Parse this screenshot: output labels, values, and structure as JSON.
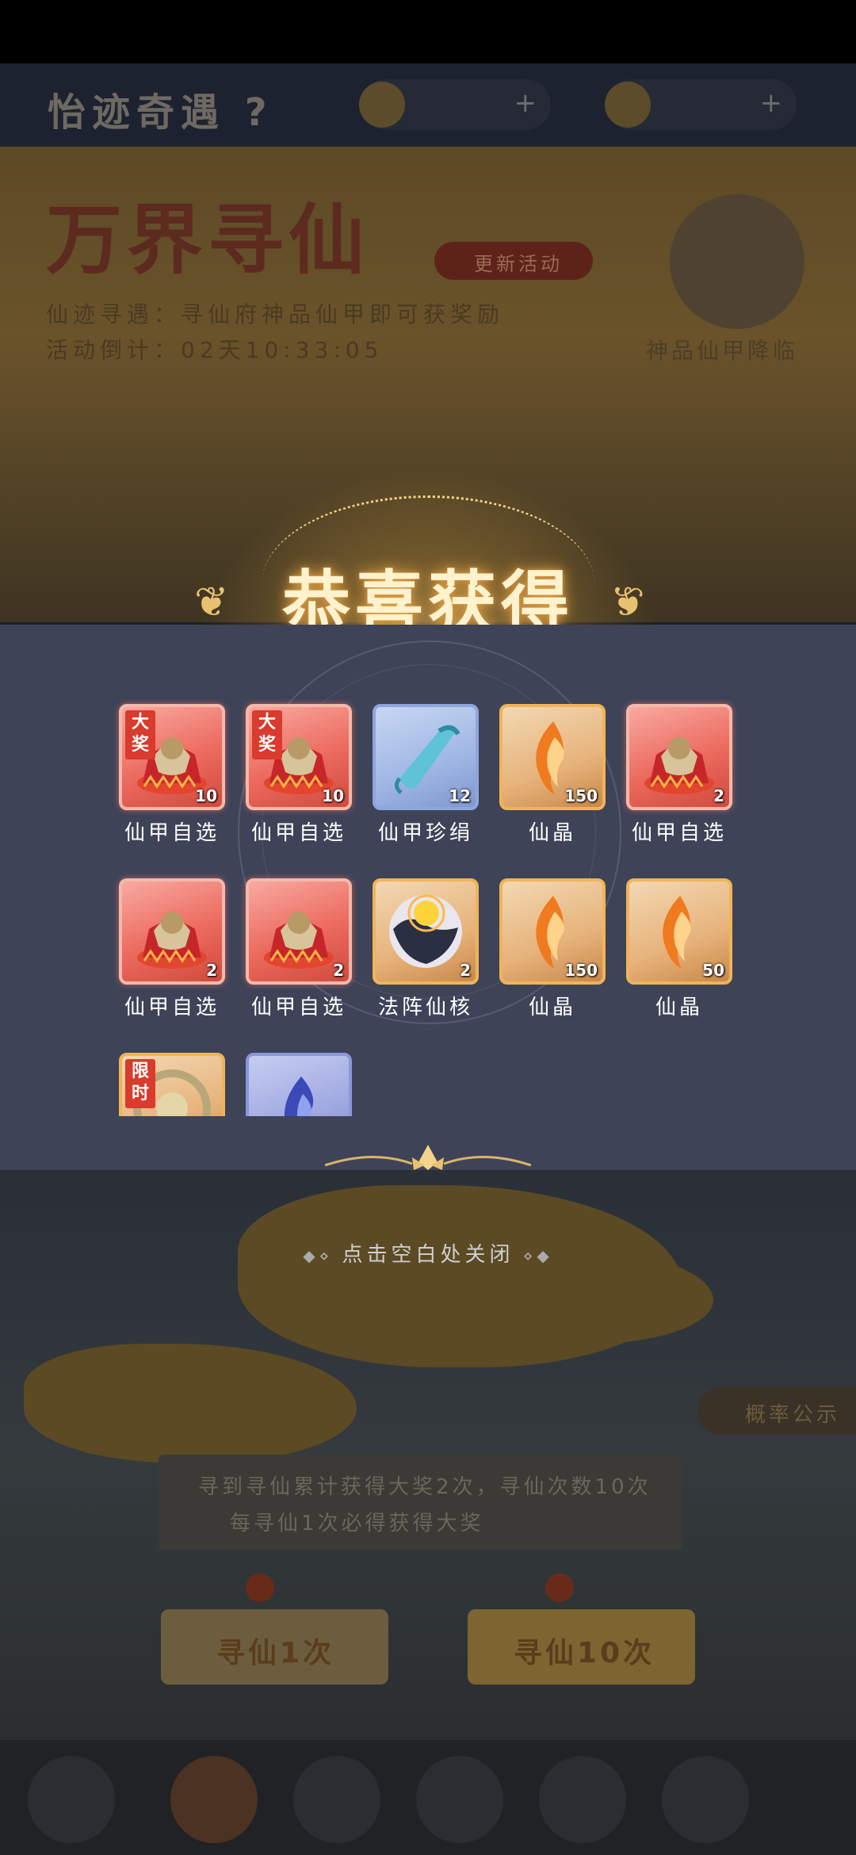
{
  "popup": {
    "title": "恭喜获得",
    "close_hint": "点击空白处关闭",
    "items": [
      {
        "name": "仙甲自选",
        "qty": "10",
        "rarity": "red",
        "tag": "大奖",
        "icon": "armor-chest-icon"
      },
      {
        "name": "仙甲自选",
        "qty": "10",
        "rarity": "red",
        "tag": "大奖",
        "icon": "armor-chest-icon"
      },
      {
        "name": "仙甲珍绢",
        "qty": "12",
        "rarity": "blue",
        "tag": "",
        "icon": "silk-scroll-icon"
      },
      {
        "name": "仙晶",
        "qty": "150",
        "rarity": "gold",
        "tag": "",
        "icon": "fire-crystal-icon"
      },
      {
        "name": "仙甲自选",
        "qty": "2",
        "rarity": "red",
        "tag": "",
        "icon": "armor-chest-icon"
      },
      {
        "name": "仙甲自选",
        "qty": "2",
        "rarity": "red",
        "tag": "",
        "icon": "armor-chest-icon"
      },
      {
        "name": "仙甲自选",
        "qty": "2",
        "rarity": "red",
        "tag": "",
        "icon": "armor-chest-icon"
      },
      {
        "name": "法阵仙核",
        "qty": "2",
        "rarity": "gold",
        "tag": "",
        "icon": "array-core-icon"
      },
      {
        "name": "仙晶",
        "qty": "150",
        "rarity": "gold",
        "tag": "",
        "icon": "fire-crystal-icon"
      },
      {
        "name": "仙晶",
        "qty": "50",
        "rarity": "gold",
        "tag": "",
        "icon": "fire-crystal-icon"
      },
      {
        "name": "",
        "qty": "",
        "rarity": "gold",
        "tag": "限时",
        "icon": "jade-disc-icon"
      },
      {
        "name": "",
        "qty": "",
        "rarity": "purple",
        "tag": "",
        "icon": "blue-flame-icon"
      }
    ]
  },
  "background": {
    "topbar_title": "怡迹奇遇 ?",
    "banner_title": "万界寻仙",
    "banner_pill": "更新活动",
    "banner_line1": "仙迹寻遇：寻仙府神品仙甲即可获奖励",
    "banner_line2": "活动倒计：02天10:33:05",
    "banner_portrait_label": "神品仙甲降临",
    "desc_line1": "寻到寻仙累计获得大奖2次，寻仙次数10次",
    "desc_line2": "每寻仙1次必得获得大奖",
    "side_tab": "概率公示",
    "btn_once": "寻仙1次",
    "btn_ten": "寻仙10次",
    "chat": "•••"
  },
  "colors": {
    "panel": "#3e4358",
    "title_glow": "#e9a94a",
    "tag_red": "#d93b2c",
    "rarity_red": "#ec6a5e",
    "rarity_gold": "#e7b37b",
    "rarity_blue": "#9fb6e4"
  }
}
